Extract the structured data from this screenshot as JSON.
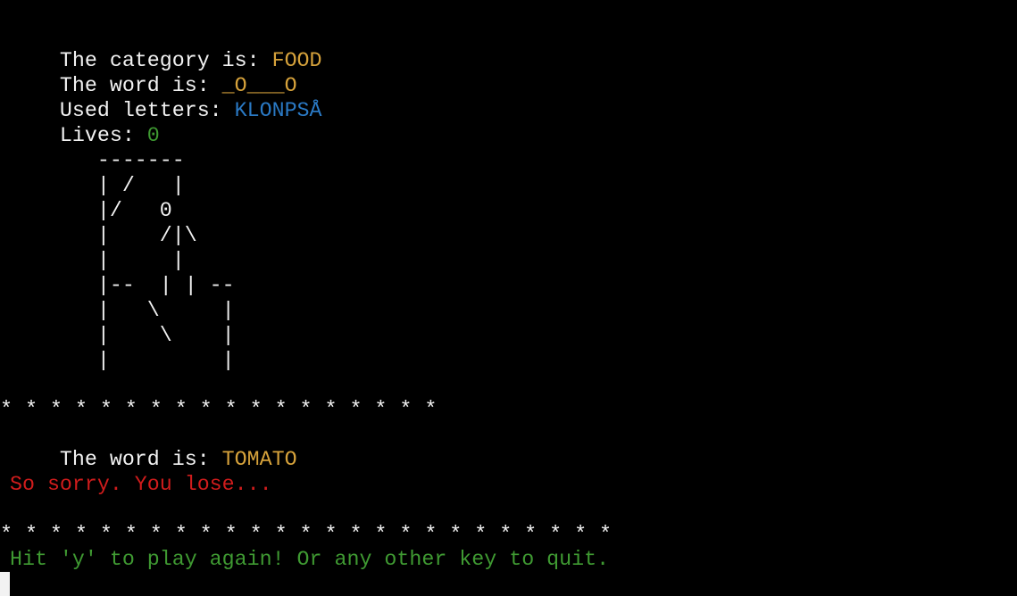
{
  "status": {
    "category_label": "The category is: ",
    "category_value": "FOOD",
    "word_label": "The word is: ",
    "word_value": "_O___O",
    "used_label": "Used letters: ",
    "used_value": "KLONPSÅ",
    "lives_label": "Lives: ",
    "lives_value": "0"
  },
  "hangman": [
    "       -------",
    "       | /   |",
    "       |/   0",
    "       |    /|\\",
    "       |     |",
    "       |--  | | --",
    "       |   \\     |",
    "       |    \\    |",
    "       |         |"
  ],
  "separator_top": "* * * * * * * * * * * * * * * * * *",
  "result": {
    "word_label": "The word is: ",
    "word_value": "TOMATO",
    "message": "So sorry. You lose..."
  },
  "separator_bottom": "* * * * * * * * * * * * * * * * * * * * * * * * *",
  "prompt": "Hit 'y' to play again! Or any other key to quit.",
  "colors": {
    "background": "#000000",
    "text": "#f2f2f2",
    "yellow": "#d6a23b",
    "blue": "#2a79c4",
    "green": "#3f9a32",
    "red": "#d01c1c"
  }
}
